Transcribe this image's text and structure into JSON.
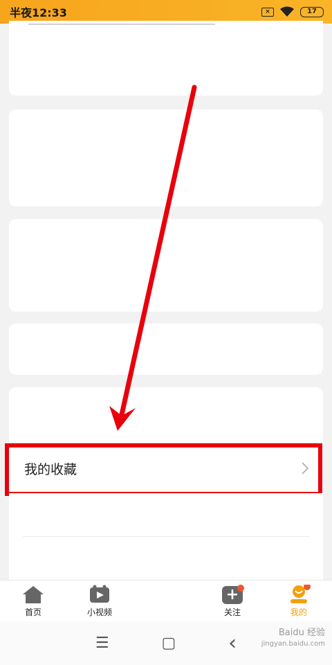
{
  "status_bar": {
    "time": "半夜12:33",
    "sim_icon": "sim-blocked-icon",
    "sim_glyph": "×",
    "wifi_icon": "wifi-icon",
    "battery_level": "17"
  },
  "list": {
    "favorites_label": "我的收藏",
    "favorites_chevron": "›"
  },
  "tabs": [
    {
      "label": "首页",
      "icon": "home-icon"
    },
    {
      "label": "小视频",
      "icon": "video-icon"
    },
    {
      "label": "",
      "icon": "center-placeholder"
    },
    {
      "label": "关注",
      "icon": "follow-add-icon"
    },
    {
      "label": "我的",
      "icon": "profile-icon"
    }
  ],
  "nav": {
    "menu_glyph": "☰",
    "home_glyph": "▢",
    "back_glyph": "‹"
  },
  "watermark": {
    "line1": "Baidu 经验",
    "line2": "jingyan.baidu.com"
  },
  "colors": {
    "accent": "#f0a10f",
    "annotation_red": "#e8000c",
    "badge": "#f0552d"
  }
}
